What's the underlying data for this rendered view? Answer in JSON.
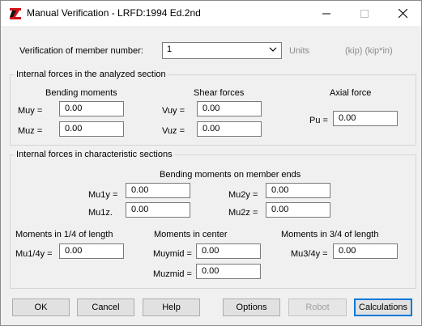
{
  "window": {
    "title": "Manual Verification - LRFD:1994 Ed.2nd",
    "buttons": {
      "minimize": "—",
      "maximize": "☐",
      "close": "✕"
    }
  },
  "member": {
    "label": "Verification of member number:",
    "value": "1",
    "units_label": "Units",
    "units_value": "(kip) (kip*in)"
  },
  "analyzed": {
    "legend": "Internal forces in the analyzed section",
    "bending_title": "Bending moments",
    "shear_title": "Shear forces",
    "axial_title": "Axial force",
    "muy_label": "Muy =",
    "muy_value": "0.00",
    "muz_label": "Muz =",
    "muz_value": "0.00",
    "vuy_label": "Vuy =",
    "vuy_value": "0.00",
    "vuz_label": "Vuz =",
    "vuz_value": "0.00",
    "pu_label": "Pu =",
    "pu_value": "0.00"
  },
  "characteristic": {
    "legend": "Internal forces in characteristic sections",
    "ends_title": "Bending moments on member ends",
    "mu1y_label": "Mu1y =",
    "mu1y_value": "0.00",
    "mu1z_label": "Mu1z.",
    "mu1z_value": "0.00",
    "mu2y_label": "Mu2y =",
    "mu2y_value": "0.00",
    "mu2z_label": "Mu2z =",
    "mu2z_value": "0.00",
    "quarter_title": "Moments in 1/4 of length",
    "mu14y_label": "Mu1/4y =",
    "mu14y_value": "0.00",
    "center_title": "Moments in center",
    "muymid_label": "Muymid =",
    "muymid_value": "0.00",
    "muzmid_label": "Muzmid =",
    "muzmid_value": "0.00",
    "threequarter_title": "Moments in 3/4 of length",
    "mu34y_label": "Mu3/4y =",
    "mu34y_value": "0.00"
  },
  "buttons": {
    "ok": "OK",
    "cancel": "Cancel",
    "help": "Help",
    "options": "Options",
    "robot": "Robot",
    "calculations": "Calculations"
  }
}
